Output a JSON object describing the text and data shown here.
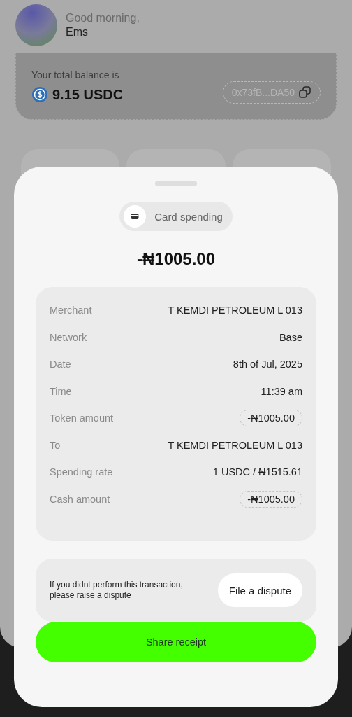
{
  "header": {
    "greeting": "Good morning,",
    "name": "Ems"
  },
  "balance": {
    "label": "Your total balance is",
    "amount": "9.15 USDC",
    "address": "0x73fB...DA50"
  },
  "sheet": {
    "category": "Card spending",
    "amount": "-₦1005.00",
    "details": [
      {
        "label": "Merchant",
        "value": "T KEMDI PETROLEUM L 013",
        "kind": "text"
      },
      {
        "label": "Network",
        "value": "Base",
        "kind": "text"
      },
      {
        "label": "Date",
        "value": "8th of Jul, 2025",
        "kind": "text"
      },
      {
        "label": "Time",
        "value": "11:39 am",
        "kind": "text"
      },
      {
        "label": "Token amount",
        "value": "-₦1005.00",
        "kind": "pill"
      },
      {
        "label": "To",
        "value": "T KEMDI PETROLEUM L 013",
        "kind": "text"
      },
      {
        "label": "Spending rate",
        "value": "1 USDC / ₦1515.61",
        "kind": "text"
      },
      {
        "label": "Cash amount",
        "value": "-₦1005.00",
        "kind": "pill"
      }
    ],
    "dispute": {
      "message": "If you didnt perform this transaction, please raise a dispute",
      "button": "File a dispute"
    },
    "share_button": "Share receipt"
  }
}
